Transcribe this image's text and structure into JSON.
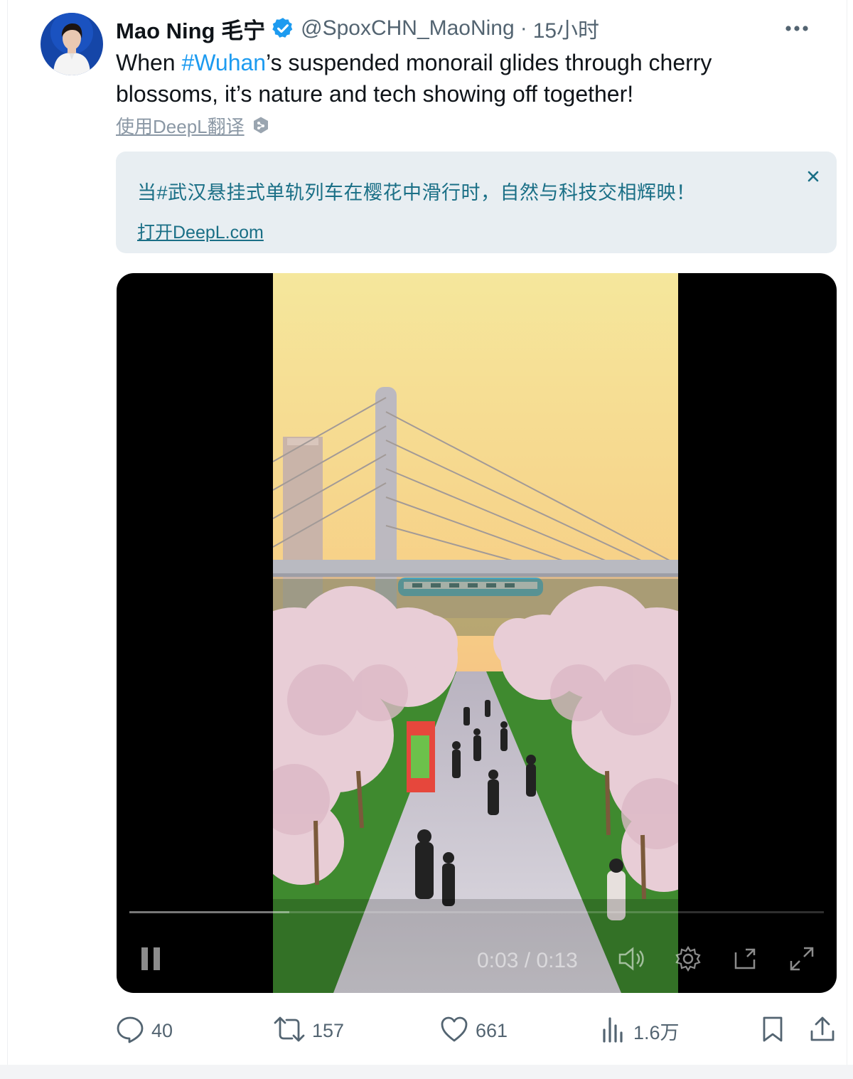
{
  "author": {
    "display_name": "Mao Ning 毛宁",
    "handle": "@SpoxCHN_MaoNing",
    "separator": "·",
    "time": "15小时"
  },
  "tweet": {
    "text_before": "When ",
    "hashtag": "#Wuhan",
    "text_after": "’s suspended monorail glides through cherry blossoms, it’s nature and tech showing off together!",
    "translate_link": "使用DeepL翻译"
  },
  "translation": {
    "text": "当#武汉悬挂式单轨列车在樱花中滑行时，自然与科技交相辉映！",
    "open_link": "打开DeepL.com"
  },
  "video": {
    "time_display": "0:03 / 0:13",
    "progress": 0.23
  },
  "actions": {
    "replies": "40",
    "reposts": "157",
    "likes": "661",
    "views": "1.6万"
  },
  "colors": {
    "accent": "#1d9bf0",
    "translation_text": "#1a6f86",
    "translation_bg": "#e8eef2",
    "muted": "#536471"
  },
  "icons": [
    "verified-badge-icon",
    "more-icon",
    "deepl-icon",
    "close-icon",
    "pause-icon",
    "volume-icon",
    "settings-icon",
    "pip-icon",
    "fullscreen-icon",
    "reply-icon",
    "repost-icon",
    "like-icon",
    "views-icon",
    "bookmark-icon",
    "share-icon"
  ]
}
